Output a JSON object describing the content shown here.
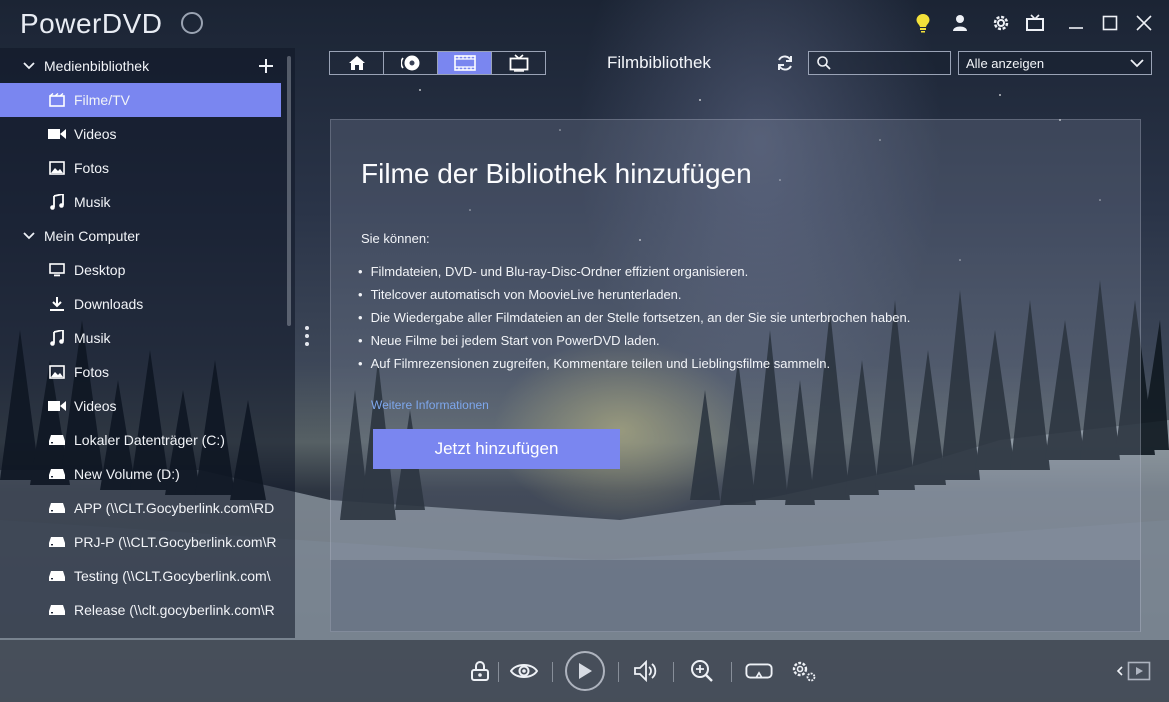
{
  "app": {
    "title": "PowerDVD"
  },
  "titlebar": {
    "icons": [
      "notification-icon",
      "lightbulb-icon",
      "user-icon",
      "settings-icon",
      "tv-mode-icon",
      "minimize-icon",
      "maximize-icon",
      "close-icon"
    ],
    "lightbulb_color": "#f3e13a"
  },
  "sidebar": {
    "groups": [
      {
        "label": "Medienbibliothek",
        "items": [
          {
            "label": "Filme/TV",
            "icon": "movie-icon",
            "active": true
          },
          {
            "label": "Videos",
            "icon": "video-camera-icon"
          },
          {
            "label": "Fotos",
            "icon": "photo-icon"
          },
          {
            "label": "Musik",
            "icon": "music-note-icon"
          }
        ]
      },
      {
        "label": "Mein Computer",
        "items": [
          {
            "label": "Desktop",
            "icon": "monitor-icon"
          },
          {
            "label": "Downloads",
            "icon": "download-icon"
          },
          {
            "label": "Musik",
            "icon": "music-note-icon"
          },
          {
            "label": "Fotos",
            "icon": "photo-icon"
          },
          {
            "label": "Videos",
            "icon": "video-camera-icon"
          },
          {
            "label": "Lokaler Datenträger (C:)",
            "icon": "drive-icon"
          },
          {
            "label": "New Volume (D:)",
            "icon": "drive-icon"
          },
          {
            "label": "APP (\\\\CLT.Gocyberlink.com\\RD",
            "icon": "network-drive-icon"
          },
          {
            "label": "PRJ-P (\\\\CLT.Gocyberlink.com\\R",
            "icon": "network-drive-icon"
          },
          {
            "label": "Testing (\\\\CLT.Gocyberlink.com\\",
            "icon": "network-drive-icon"
          },
          {
            "label": "Release (\\\\clt.gocyberlink.com\\R",
            "icon": "network-drive-icon"
          }
        ]
      }
    ],
    "accent": "#7a86f0"
  },
  "toolbar": {
    "nav_tabs": [
      {
        "icon": "home-icon"
      },
      {
        "icon": "disc-icon"
      },
      {
        "icon": "film-strip-icon",
        "active": true
      },
      {
        "icon": "tv-icon"
      }
    ],
    "page_title": "Filmbibliothek",
    "search_placeholder": "",
    "filter_value": "Alle anzeigen"
  },
  "main": {
    "heading": "Filme der Bibliothek hinzufügen",
    "intro": "Sie können:",
    "bullets": [
      "Filmdateien, DVD- und Blu-ray-Disc-Ordner effizient organisieren.",
      "Titelcover automatisch von MoovieLive herunterladen.",
      "Die Wiedergabe aller Filmdateien an der Stelle fortsetzen, an der Sie sie unterbrochen haben.",
      "Neue Filme bei jedem Start von PowerDVD laden.",
      "Auf Filmrezensionen zugreifen, Kommentare teilen und Lieblingsfilme sammeln."
    ],
    "more_link": "Weitere Informationen",
    "add_button": "Jetzt hinzufügen"
  },
  "bottombar": {
    "icons": [
      "lock-icon",
      "eye-icon",
      "play-icon",
      "volume-icon",
      "zoom-icon",
      "vr-headset-icon",
      "advanced-settings-icon",
      "mini-player-icon"
    ]
  }
}
